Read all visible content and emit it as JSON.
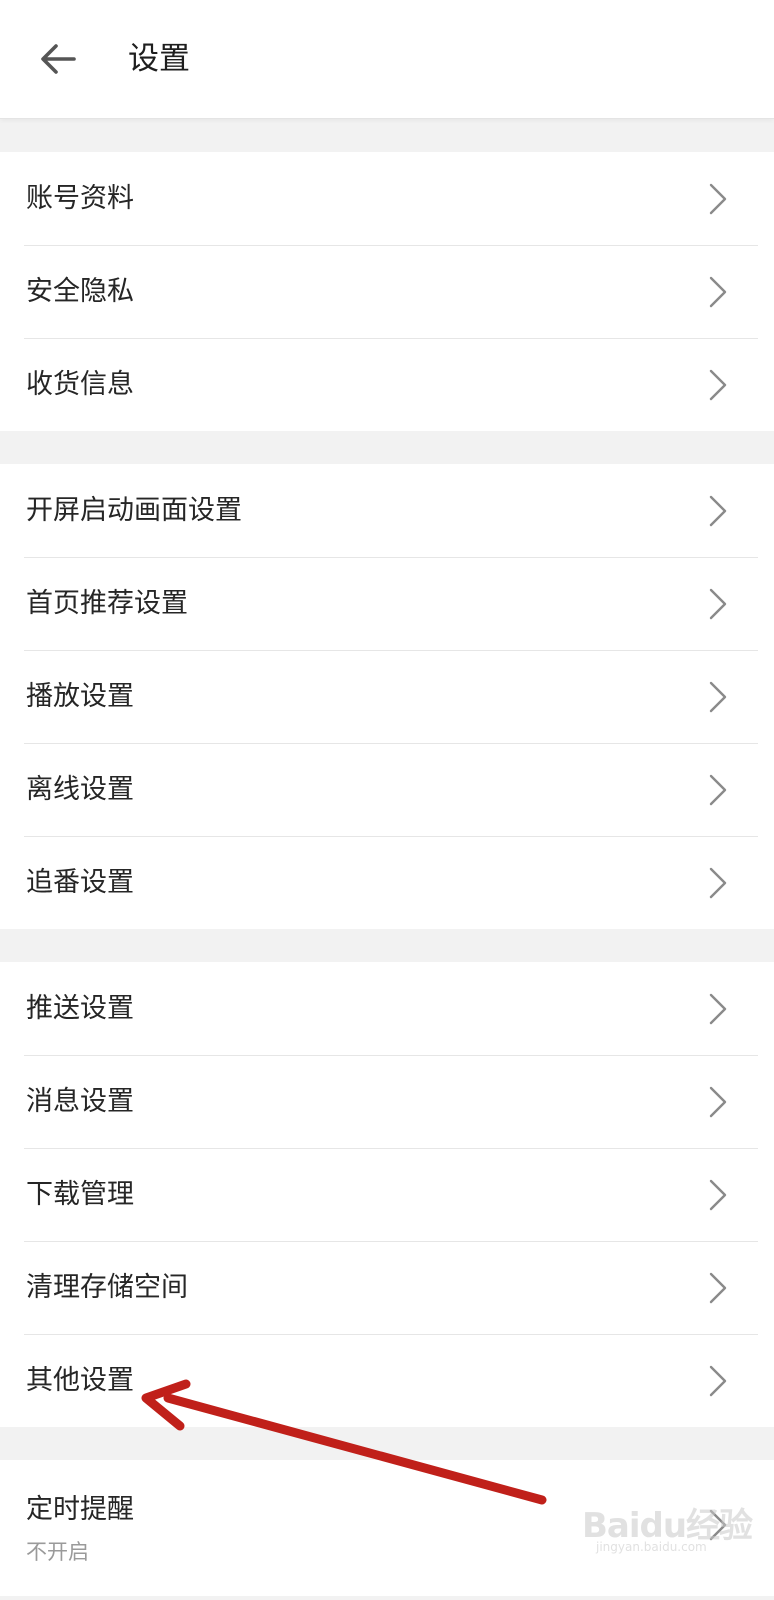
{
  "header": {
    "title": "设置",
    "back_icon": "arrow-left-icon"
  },
  "groups": [
    {
      "items": [
        {
          "label": "账号资料"
        },
        {
          "label": "安全隐私"
        },
        {
          "label": "收货信息"
        }
      ]
    },
    {
      "items": [
        {
          "label": "开屏启动画面设置"
        },
        {
          "label": "首页推荐设置"
        },
        {
          "label": "播放设置"
        },
        {
          "label": "离线设置"
        },
        {
          "label": "追番设置"
        }
      ]
    },
    {
      "items": [
        {
          "label": "推送设置"
        },
        {
          "label": "消息设置"
        },
        {
          "label": "下载管理"
        },
        {
          "label": "清理存储空间"
        },
        {
          "label": "其他设置"
        }
      ]
    },
    {
      "items": [
        {
          "label": "定时提醒",
          "sublabel": "不开启"
        }
      ]
    }
  ],
  "annotation": {
    "arrow_color": "#c0201a",
    "target_item": "其他设置"
  },
  "watermark": {
    "logo_text": "Baidu经验",
    "url_text": "jingyan.baidu.com"
  },
  "colors": {
    "background": "#f2f2f2",
    "card": "#ffffff",
    "divider": "#e6e6e6",
    "chevron": "#8a8a8a",
    "sublabel": "#9a9a9a"
  }
}
